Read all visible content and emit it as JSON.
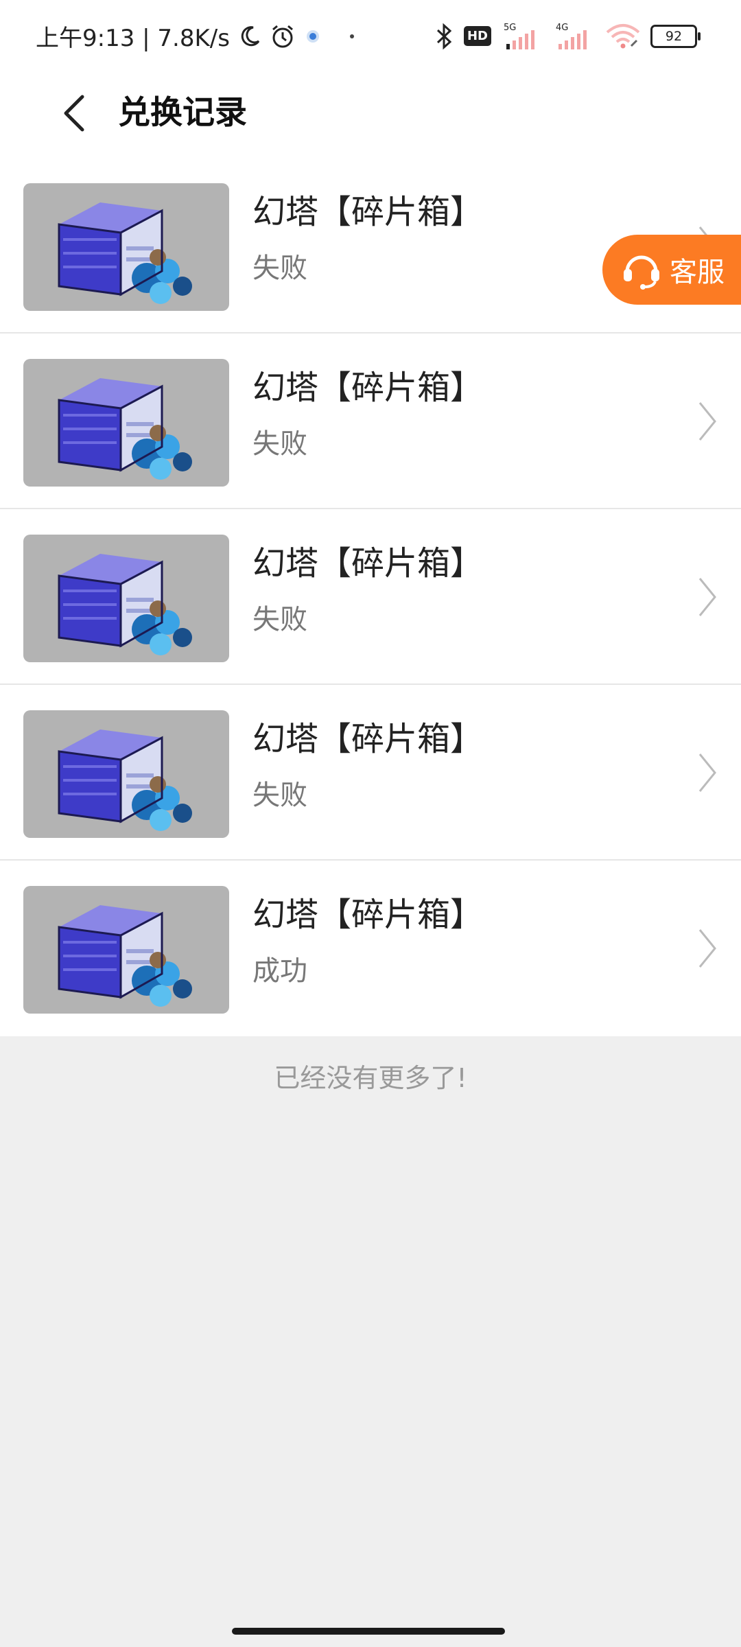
{
  "status_bar": {
    "time_speed": "上午9:13 | 7.8K/s",
    "signal_5g": "5G",
    "signal_4g": "4G",
    "hd": "HD",
    "battery": "92"
  },
  "header": {
    "title": "兑换记录"
  },
  "records": [
    {
      "title": "幻塔【碎片箱】",
      "status": "失败"
    },
    {
      "title": "幻塔【碎片箱】",
      "status": "失败"
    },
    {
      "title": "幻塔【碎片箱】",
      "status": "失败"
    },
    {
      "title": "幻塔【碎片箱】",
      "status": "失败"
    },
    {
      "title": "幻塔【碎片箱】",
      "status": "成功"
    }
  ],
  "footer": {
    "end_text": "已经没有更多了!"
  },
  "customer_service": {
    "label": "客服"
  },
  "colors": {
    "accent": "#fc7b23",
    "background": "#efefef"
  }
}
